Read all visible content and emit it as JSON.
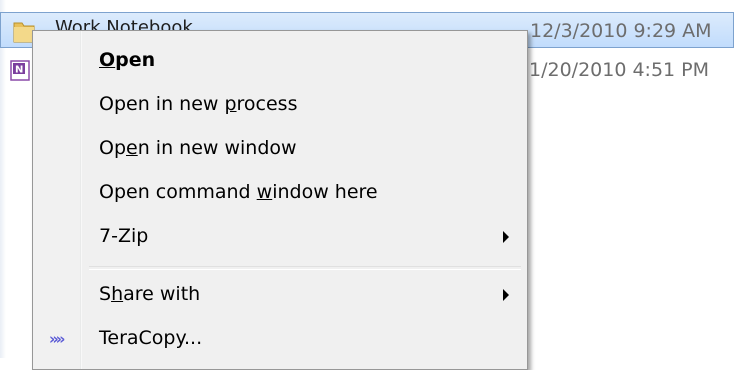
{
  "files": [
    {
      "name": "Work Notebook",
      "date": "12/3/2010 9:29 AM",
      "icon": "folder-icon",
      "selected": true
    },
    {
      "name": "",
      "date": "1/20/2010 4:51 PM",
      "icon": "onenote-icon",
      "selected": false
    }
  ],
  "menu": {
    "items": [
      {
        "id": "open",
        "label_pre": "",
        "label_key": "O",
        "label_post": "pen",
        "bold": true,
        "submenu": false
      },
      {
        "id": "open-new-process",
        "label_pre": "Open in new ",
        "label_key": "p",
        "label_post": "rocess",
        "bold": false,
        "submenu": false
      },
      {
        "id": "open-new-window",
        "label_pre": "Op",
        "label_key": "e",
        "label_post": "n in new window",
        "bold": false,
        "submenu": false
      },
      {
        "id": "open-command-window",
        "label_pre": "Open command ",
        "label_key": "w",
        "label_post": "indow here",
        "bold": false,
        "submenu": false
      },
      {
        "id": "7zip",
        "label_pre": "7-Zip",
        "label_key": "",
        "label_post": "",
        "bold": false,
        "submenu": true
      },
      {
        "id": "share-with",
        "label_pre": "S",
        "label_key": "h",
        "label_post": "are with",
        "bold": false,
        "submenu": true
      },
      {
        "id": "teracopy",
        "label_pre": "TeraCopy...",
        "label_key": "",
        "label_post": "",
        "bold": false,
        "submenu": false,
        "icon": "teracopy-icon",
        "icon_glyph": "»»"
      }
    ]
  },
  "colors": {
    "selection": "#c1dcfc",
    "menu_bg": "#f0f0f0",
    "date_text": "#6d6d6d",
    "teracopy_icon": "#5b5bd6"
  }
}
